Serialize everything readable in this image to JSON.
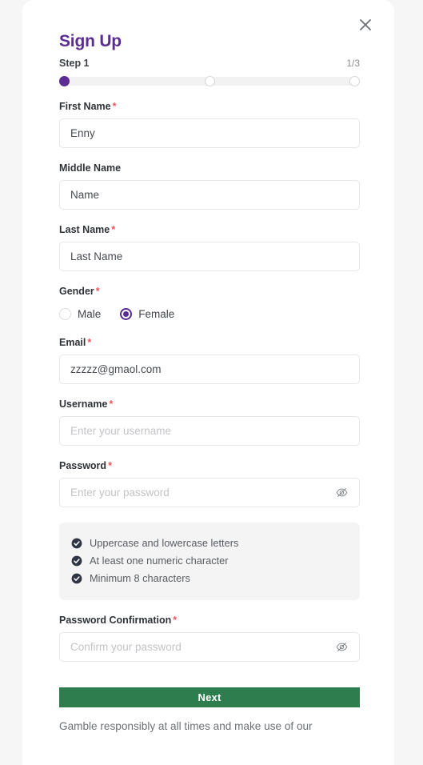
{
  "modal": {
    "title": "Sign Up",
    "close_icon": "close-icon",
    "step_label": "Step 1",
    "step_count": "1/3",
    "progress": {
      "total_steps": 3,
      "current_step": 1,
      "dots": [
        "done",
        "todo",
        "todo"
      ]
    }
  },
  "fields": {
    "first_name": {
      "label": "First Name",
      "required": true,
      "value": "Enny",
      "state": "filled"
    },
    "middle_name": {
      "label": "Middle Name",
      "required": false,
      "value": "Name",
      "state": "filled"
    },
    "last_name": {
      "label": "Last Name",
      "required": true,
      "value": "Last Name",
      "state": "filled"
    },
    "gender": {
      "label": "Gender",
      "required": true,
      "selected": "Female",
      "options": [
        {
          "label": "Male",
          "selected": false
        },
        {
          "label": "Female",
          "selected": true
        }
      ]
    },
    "email": {
      "label": "Email",
      "required": true,
      "value": "zzzzz@gmaol.com",
      "state": "filled"
    },
    "username": {
      "label": "Username",
      "required": true,
      "value": "Enter your username",
      "state": "placeholder"
    },
    "password": {
      "label": "Password",
      "required": true,
      "value": "Enter your password",
      "state": "placeholder",
      "toggle_icon": "eye-slash-icon"
    },
    "password_confirmation": {
      "label": "Password Confirmation",
      "required": true,
      "value": "Confirm your password",
      "state": "placeholder",
      "toggle_icon": "eye-slash-icon"
    }
  },
  "password_requirements": [
    {
      "text": "Uppercase and lowercase letters",
      "met": true
    },
    {
      "text": "At least one numeric character",
      "met": true
    },
    {
      "text": "Minimum 8 characters",
      "met": true
    }
  ],
  "actions": {
    "next_label": "Next"
  },
  "footer": {
    "note": "Gamble responsibly at all times and make use of our"
  },
  "required_marker": "*",
  "colors": {
    "brand_purple": "#5b2c91",
    "required_red": "#f4555c",
    "next_green": "#2e7d4f",
    "requirements_bg": "#f4f4f5",
    "check_dark": "#2f3542",
    "page_bg": "#f6f6f6"
  }
}
